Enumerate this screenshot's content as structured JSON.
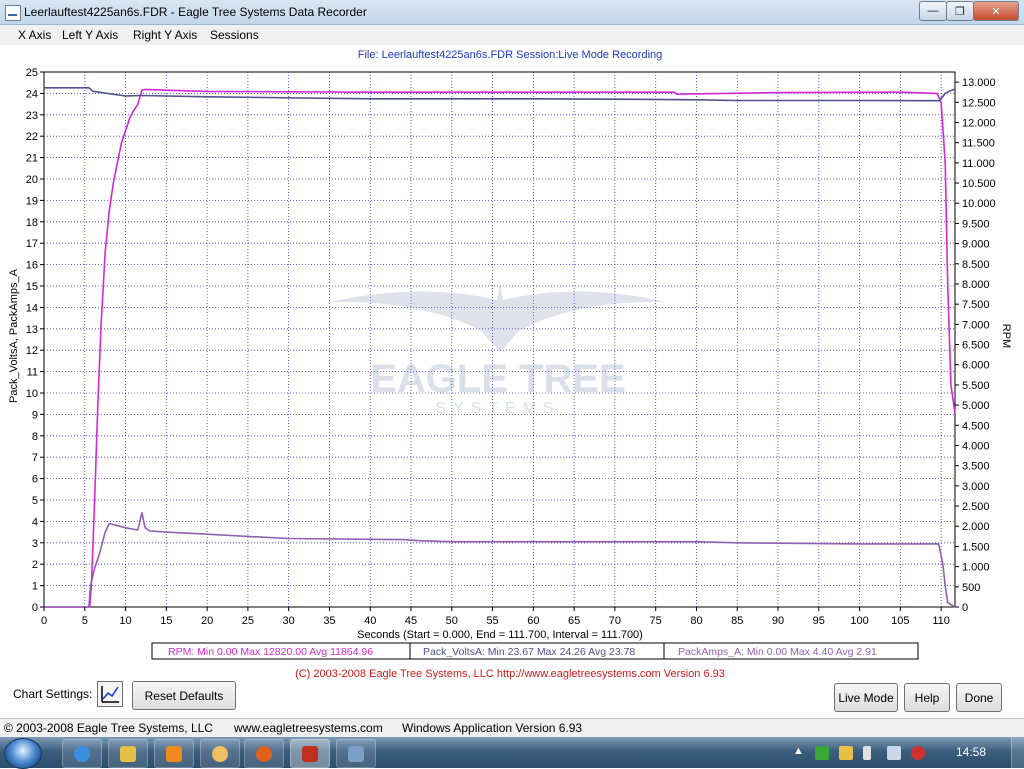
{
  "window": {
    "title": "Leerlauftest4225an6s.FDR - Eagle Tree Systems Data Recorder",
    "minimize": "—",
    "maximize": "❐",
    "close": "✕"
  },
  "menu": [
    {
      "label": "X Axis"
    },
    {
      "label": "Left Y Axis"
    },
    {
      "label": "Right Y Axis"
    },
    {
      "label": "Sessions"
    }
  ],
  "chart_data": {
    "type": "line",
    "title": "File: Leerlauftest4225an6s.FDR   Session:Live Mode Recording",
    "xlabel": "Seconds (Start = 0.000,  End = 111.700,  Interval =  111.700)",
    "ylabel_left": "Pack_VoltsA, PackAmps_A",
    "ylabel_right": "RPM",
    "xlim": [
      0,
      111.7
    ],
    "ylim_left": [
      0,
      25
    ],
    "ylim_right": [
      0,
      13250
    ],
    "x_ticks": [
      "0",
      "5",
      "10",
      "15",
      "20",
      "25",
      "30",
      "35",
      "40",
      "45",
      "50",
      "55",
      "60",
      "65",
      "70",
      "75",
      "80",
      "85",
      "90",
      "95",
      "100",
      "105",
      "110"
    ],
    "y_left_ticks": [
      "0",
      "1",
      "2",
      "3",
      "4",
      "5",
      "6",
      "7",
      "8",
      "9",
      "10",
      "11",
      "12",
      "13",
      "14",
      "15",
      "16",
      "17",
      "18",
      "19",
      "20",
      "21",
      "22",
      "23",
      "24",
      "25"
    ],
    "y_right_ticks": [
      "0",
      "500",
      "1.000",
      "1.500",
      "2.000",
      "2.500",
      "3.000",
      "3.500",
      "4.000",
      "4.500",
      "5.000",
      "5.500",
      "6.000",
      "6.500",
      "7.000",
      "7.500",
      "8.000",
      "8.500",
      "9.000",
      "9.500",
      "10.000",
      "10.500",
      "11.000",
      "11.500",
      "12.000",
      "12.500",
      "13.000"
    ],
    "grid": true,
    "series": [
      {
        "name": "RPM",
        "color": "#d428d4",
        "axis": "right",
        "x": [
          0,
          5.6,
          5.8,
          6.0,
          6.3,
          6.6,
          7.0,
          7.5,
          8.0,
          8.5,
          9.0,
          9.5,
          10.0,
          10.5,
          11.0,
          11.5,
          12.0,
          12.5,
          15,
          20,
          40,
          77.3,
          77.6,
          90,
          105,
          109.5,
          110.0,
          110.5,
          110.8,
          111.2,
          111.7
        ],
        "values": [
          0,
          0,
          500,
          1500,
          3200,
          5000,
          7000,
          8800,
          9800,
          10500,
          11000,
          11500,
          11800,
          12100,
          12300,
          12450,
          12800,
          12820,
          12800,
          12770,
          12750,
          12750,
          12700,
          12740,
          12750,
          12720,
          12500,
          11000,
          8000,
          5500,
          4800
        ]
      },
      {
        "name": "Pack_VoltsA",
        "color": "#50508c",
        "axis": "left",
        "x": [
          0,
          5.5,
          6,
          10,
          12,
          20,
          40,
          60,
          75,
          80,
          85,
          100,
          108,
          109.8,
          110.5,
          111.0,
          111.7
        ],
        "values": [
          24.26,
          24.26,
          24.1,
          23.88,
          23.9,
          23.84,
          23.75,
          23.75,
          23.72,
          23.7,
          23.67,
          23.67,
          23.66,
          23.66,
          24.0,
          24.1,
          24.2
        ]
      },
      {
        "name": "PackAmps_A",
        "color": "#9060b0",
        "axis": "left",
        "x": [
          0,
          5.5,
          5.7,
          6.2,
          6.8,
          7.5,
          8.0,
          10.0,
          11.5,
          12.0,
          12.4,
          13.0,
          15,
          20,
          25,
          30,
          44,
          46,
          50,
          60,
          70,
          80,
          85,
          90,
          100,
          109.7,
          110.2,
          110.5,
          110.8,
          111.7
        ],
        "values": [
          0,
          0,
          1.0,
          1.8,
          2.5,
          3.5,
          3.9,
          3.7,
          3.6,
          4.4,
          3.7,
          3.55,
          3.5,
          3.4,
          3.3,
          3.2,
          3.15,
          3.1,
          3.05,
          3.05,
          3.05,
          3.05,
          3.0,
          2.98,
          2.95,
          2.95,
          2.0,
          1.0,
          0.2,
          0
        ]
      }
    ]
  },
  "stats": {
    "rpm": "RPM:  Min 0.00    Max 12820.00    Avg 11864.96",
    "volts": "Pack_VoltsA:   Min 23.67    Max 24.26    Avg 23.78",
    "amps": "PackAmps_A:   Min 0.00    Max 4.40    Avg 2.91"
  },
  "copyright_line": "(C) 2003-2008 Eagle Tree Systems, LLC      http://www.eagletreesystems.com      Version 6.93",
  "watermark": {
    "line1": "EAGLE TREE",
    "line2": "SYSTEMS"
  },
  "bottom": {
    "chart_settings_label": "Chart Settings:",
    "reset_defaults": "Reset Defaults",
    "live_mode": "Live Mode",
    "help": "Help",
    "done": "Done"
  },
  "status_bar": {
    "copyright": "© 2003-2008 Eagle Tree Systems, LLC",
    "website": "www.eagletreesystems.com",
    "version": "Windows Application Version 6.93"
  },
  "taskbar": {
    "clock": "14:58",
    "buttons": [
      {
        "name": "ie",
        "color": "#3b8ee0"
      },
      {
        "name": "explorer",
        "color": "#e8c048"
      },
      {
        "name": "media-player",
        "color": "#f08a20"
      },
      {
        "name": "outlook-express",
        "color": "#f0c060"
      },
      {
        "name": "firefox",
        "color": "#e0601c"
      },
      {
        "name": "eagle-tree-recorder",
        "color": "#c03020"
      },
      {
        "name": "control-panel",
        "color": "#7aa0c8"
      }
    ]
  }
}
